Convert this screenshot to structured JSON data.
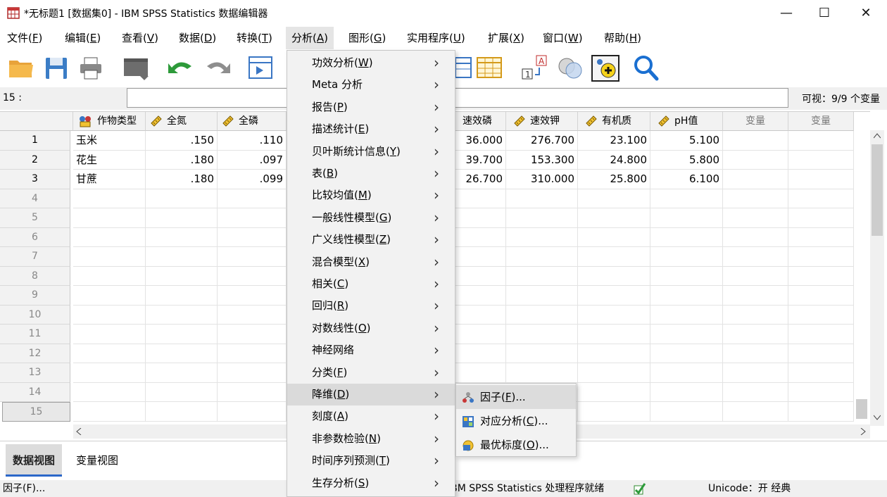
{
  "window": {
    "title": "*无标题1 [数据集0] - IBM SPSS Statistics 数据编辑器",
    "minimize": "—",
    "maximize": "☐",
    "close": "✕"
  },
  "menubar": [
    {
      "label": "文件(",
      "key": "F",
      "end": ")"
    },
    {
      "label": "编辑(",
      "key": "E",
      "end": ")"
    },
    {
      "label": "查看(",
      "key": "V",
      "end": ")"
    },
    {
      "label": "数据(",
      "key": "D",
      "end": ")"
    },
    {
      "label": "转换(",
      "key": "T",
      "end": ")"
    },
    {
      "label": "分析(",
      "key": "A",
      "end": ")"
    },
    {
      "label": "图形(",
      "key": "G",
      "end": ")"
    },
    {
      "label": "实用程序(",
      "key": "U",
      "end": ")"
    },
    {
      "label": "扩展(",
      "key": "X",
      "end": ")"
    },
    {
      "label": "窗口(",
      "key": "W",
      "end": ")"
    },
    {
      "label": "帮助(",
      "key": "H",
      "end": ")"
    }
  ],
  "refbar": {
    "cell_ref": "15 :",
    "visible": "可视：9/9 个变量"
  },
  "grid": {
    "columns_left": [
      "作物类型",
      "全氮",
      "全磷"
    ],
    "columns_right": [
      "速效磷",
      "速效钾",
      "有机质",
      "pH值",
      "变量",
      "变量"
    ],
    "row_numbers": [
      "1",
      "2",
      "3",
      "4",
      "5",
      "6",
      "7",
      "8",
      "9",
      "10",
      "11",
      "12",
      "13",
      "14",
      "15"
    ],
    "rows": [
      {
        "crop": "玉米",
        "n": ".150",
        "p": ".110",
        "ap": "36.000",
        "ak": "276.700",
        "om": "23.100",
        "ph": "5.100"
      },
      {
        "crop": "花生",
        "n": ".180",
        "p": ".097",
        "ap": "39.700",
        "ak": "153.300",
        "om": "24.800",
        "ph": "5.800"
      },
      {
        "crop": "甘蔗",
        "n": ".180",
        "p": ".099",
        "ap": "26.700",
        "ak": "310.000",
        "om": "25.800",
        "ph": "6.100"
      }
    ]
  },
  "analyze_menu": [
    {
      "label": "功效分析(",
      "key": "W",
      "end": ")"
    },
    {
      "label": "Meta 分析",
      "key": "",
      "end": ""
    },
    {
      "label": "报告(",
      "key": "P",
      "end": ")"
    },
    {
      "label": "描述统计(",
      "key": "E",
      "end": ")"
    },
    {
      "label": "贝叶斯统计信息(",
      "key": "Y",
      "end": ")"
    },
    {
      "label": "表(",
      "key": "B",
      "end": ")"
    },
    {
      "label": "比较均值(",
      "key": "M",
      "end": ")"
    },
    {
      "label": "一般线性模型(",
      "key": "G",
      "end": ")"
    },
    {
      "label": "广义线性模型(",
      "key": "Z",
      "end": ")"
    },
    {
      "label": "混合模型(",
      "key": "X",
      "end": ")"
    },
    {
      "label": "相关(",
      "key": "C",
      "end": ")"
    },
    {
      "label": "回归(",
      "key": "R",
      "end": ")"
    },
    {
      "label": "对数线性(",
      "key": "O",
      "end": ")"
    },
    {
      "label": "神经网络",
      "key": "",
      "end": ""
    },
    {
      "label": "分类(",
      "key": "F",
      "end": ")"
    },
    {
      "label": "降维(",
      "key": "D",
      "end": ")"
    },
    {
      "label": "刻度(",
      "key": "A",
      "end": ")"
    },
    {
      "label": "非参数检验(",
      "key": "N",
      "end": ")"
    },
    {
      "label": "时间序列预测(",
      "key": "T",
      "end": ")"
    },
    {
      "label": "生存分析(",
      "key": "S",
      "end": ")"
    }
  ],
  "dimension_submenu": [
    {
      "label": "因子(",
      "key": "F",
      "end": ")...",
      "icon": "factor-icon"
    },
    {
      "label": "对应分析(",
      "key": "C",
      "end": ")...",
      "icon": "correspondence-icon"
    },
    {
      "label": "最优标度(",
      "key": "O",
      "end": ")...",
      "icon": "optimal-scaling-icon"
    }
  ],
  "tabs": {
    "data_view": "数据视图",
    "variable_view": "变量视图"
  },
  "status": {
    "left": "因子(F)...",
    "processor": "IBM SPSS Statistics 处理程序就绪",
    "unicode": "Unicode：开  经典"
  },
  "colors": {
    "accent": "#2b67c9",
    "menu_bg": "#f2f2f2",
    "highlight": "#dadada"
  }
}
